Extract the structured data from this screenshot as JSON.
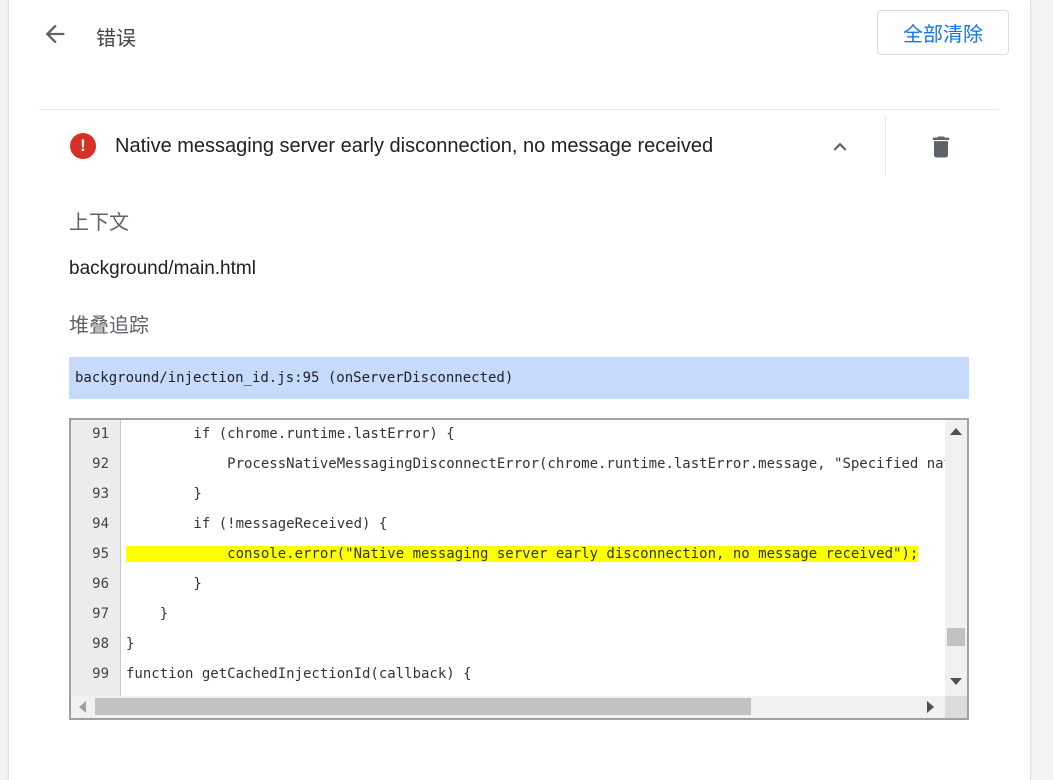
{
  "header": {
    "title": "错误",
    "clear_all_label": "全部清除"
  },
  "error": {
    "message": "Native messaging server early disconnection, no message received"
  },
  "context": {
    "label": "上下文",
    "value": "background/main.html"
  },
  "stack_trace": {
    "label": "堆叠追踪",
    "frame": "background/injection_id.js:95 (onServerDisconnected)"
  },
  "code": {
    "lines": [
      {
        "num": "91",
        "text": "        if (chrome.runtime.lastError) {"
      },
      {
        "num": "92",
        "text": "            ProcessNativeMessagingDisconnectError(chrome.runtime.lastError.message, \"Specified native :"
      },
      {
        "num": "93",
        "text": "        }"
      },
      {
        "num": "94",
        "text": "        if (!messageReceived) {"
      },
      {
        "num": "95",
        "text": "            console.error(\"Native messaging server early disconnection, no message received\");"
      },
      {
        "num": "96",
        "text": "        }"
      },
      {
        "num": "97",
        "text": "    }"
      },
      {
        "num": "98",
        "text": "}"
      },
      {
        "num": "99",
        "text": "function getCachedInjectionId(callback) {"
      }
    ]
  },
  "colors": {
    "accent": "#1a73e8",
    "error_icon": "#d93025",
    "frame_highlight": "#c6dafc",
    "line_highlight": "#ffff00"
  },
  "icons": {
    "back": "arrow-left-icon",
    "error": "error-circle-icon",
    "collapse": "chevron-up-icon",
    "delete": "trash-icon"
  }
}
